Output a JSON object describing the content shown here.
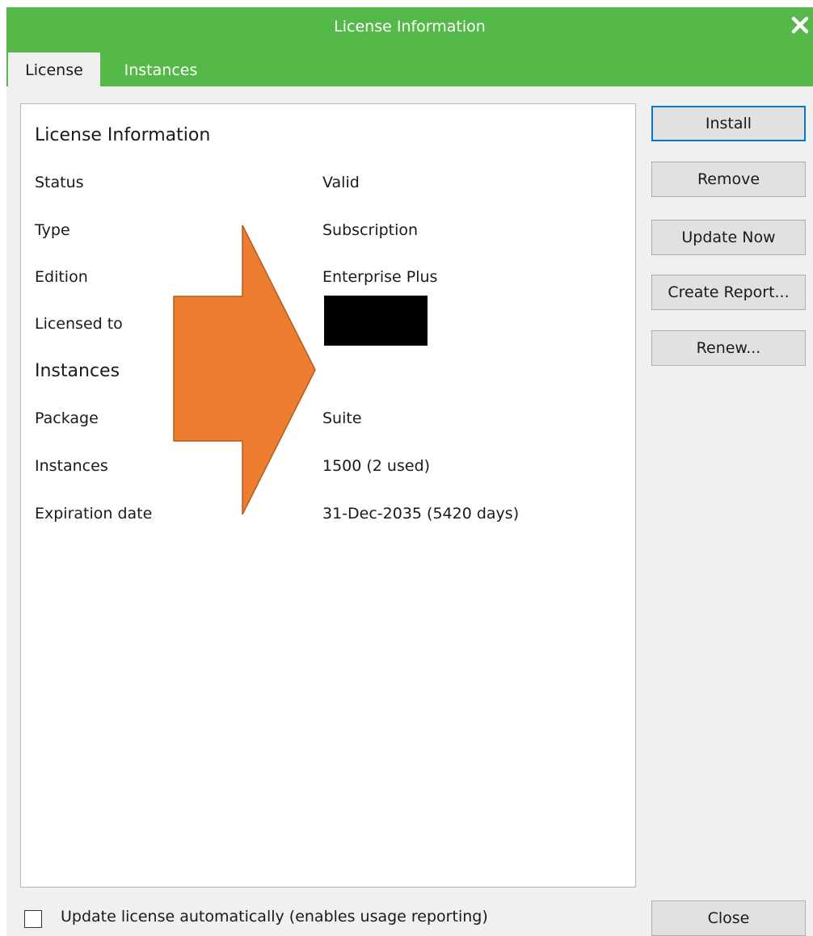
{
  "window": {
    "title": "License Information",
    "accent_color": "#54b948",
    "close_icon": "close-icon"
  },
  "tabs": [
    {
      "label": "License",
      "active": true
    },
    {
      "label": "Instances",
      "active": false
    }
  ],
  "license_section": {
    "heading": "License Information",
    "rows": [
      {
        "label": "Status",
        "value": "Valid"
      },
      {
        "label": "Type",
        "value": "Subscription"
      },
      {
        "label": "Edition",
        "value": "Enterprise Plus"
      },
      {
        "label": "Licensed to",
        "value": ""
      }
    ]
  },
  "instances_section": {
    "heading": "Instances",
    "rows": [
      {
        "label": "Package",
        "value": "Suite"
      },
      {
        "label": "Instances",
        "value": "1500 (2 used)"
      },
      {
        "label": "Expiration date",
        "value": "31-Dec-2035 (5420 days)"
      }
    ]
  },
  "annotation": {
    "arrow_color": "#ed7d31"
  },
  "buttons": {
    "install": "Install",
    "remove": "Remove",
    "update_now": "Update Now",
    "create_report": "Create Report...",
    "renew": "Renew...",
    "close": "Close"
  },
  "auto_update": {
    "label": "Update license automatically (enables usage reporting)",
    "checked": false
  }
}
